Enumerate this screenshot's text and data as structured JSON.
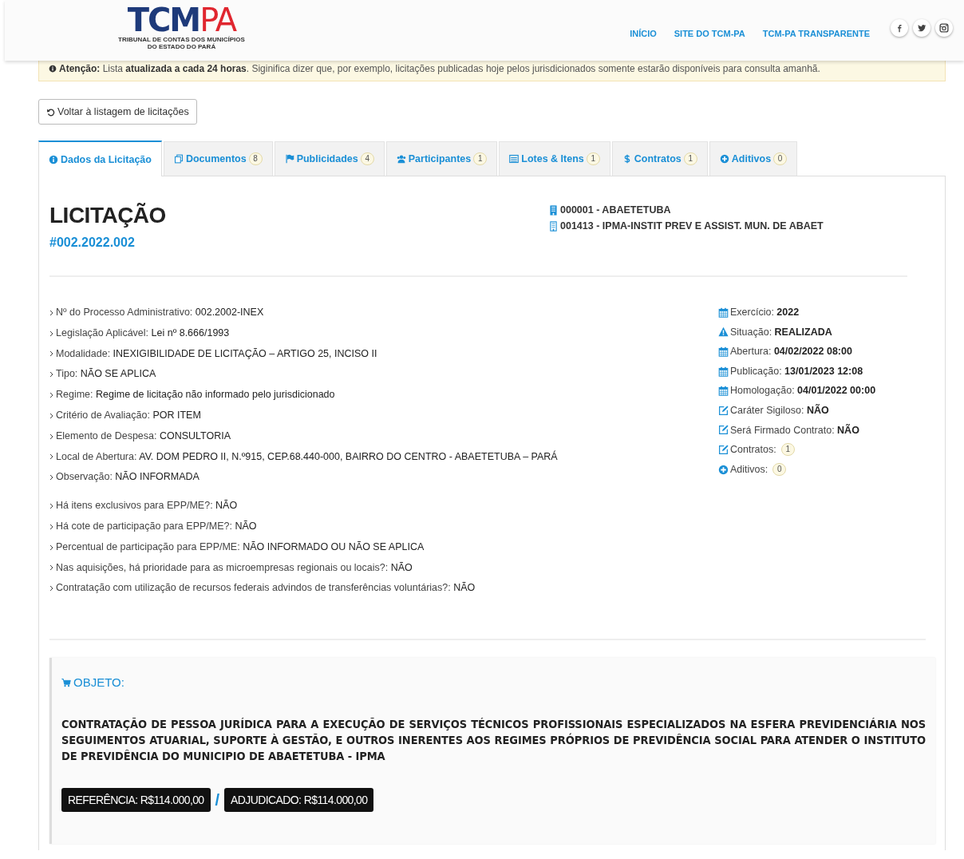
{
  "header": {
    "logo": {
      "dark": "TCM",
      "accent": "PA",
      "subtitle_lines": [
        "TRIBUNAL DE CONTAS DOS MUNICÍPIOS",
        "DO ESTADO DO PARÁ"
      ]
    },
    "nav": [
      "INÍCIO",
      "SITE DO TCM-PA",
      "TCM-PA TRANSPARENTE"
    ],
    "social": [
      {
        "kind": "facebook"
      },
      {
        "kind": "twitter"
      },
      {
        "kind": "instagram"
      }
    ]
  },
  "notice": {
    "text": "**Atenção:** Lista **atualizada a cada 24 horas**. Siginifica dizer que, por exemplo, licitações publicadas hoje pelos jurisdicionados somente estarão disponíveis para consulta amanhã."
  },
  "back_button": "Voltar à listagem de licitações",
  "tabs": [
    {
      "label": "Dados da Licitação",
      "kind": "info",
      "selected": true
    },
    {
      "label": "Documentos",
      "kind": "documents",
      "count": "8",
      "selected": false
    },
    {
      "label": "Publicidades",
      "kind": "publicity",
      "count": "4",
      "selected": false
    },
    {
      "label": "Participantes",
      "kind": "participants",
      "count": "1",
      "selected": false
    },
    {
      "label": "Lotes & Itens",
      "kind": "lots",
      "count": "1",
      "selected": false
    },
    {
      "label": "Contratos",
      "kind": "contracts",
      "count": "1",
      "selected": false
    },
    {
      "label": "Aditivos",
      "kind": "amendments",
      "count": "0",
      "selected": false
    }
  ],
  "detail": {
    "title": "LICITAÇÃO",
    "number": "#002.2022.002",
    "units": [
      {
        "kind": "municipality",
        "text": "000001 - ABAETETUBA"
      },
      {
        "kind": "entity",
        "text": "001413 - IPMA-INSTIT PREV E ASSIST. MUN. DE ABAET"
      }
    ],
    "field_groups": [
      [
        {
          "label": "Nº do Processo Administrativo:",
          "value": "002.2002-INEX"
        },
        {
          "label": "Legislação Aplicável:",
          "value": "Lei nº 8.666/1993"
        },
        {
          "label": "Modalidade:",
          "value": "INEXIGIBILIDADE DE LICITAÇÃO – ARTIGO 25, INCISO II"
        },
        {
          "label": "Tipo:",
          "value": "NÃO SE APLICA"
        },
        {
          "label": "Regime:",
          "value": "Regime de licitação não informado pelo jurisdicionado"
        },
        {
          "label": "Critério de Avaliação:",
          "value": "POR ITEM"
        },
        {
          "label": "Elemento de Despesa:",
          "value": "CONSULTORIA"
        },
        {
          "label": "Local de Abertura:",
          "value": "AV. DOM PEDRO II, N.º915, CEP.68.440-000, BAIRRO DO CENTRO - ABAETETUBA – PARÁ"
        },
        {
          "label": "Observação:",
          "value": "NÃO INFORMADA"
        }
      ],
      [
        {
          "label": "Há itens exclusivos para EPP/ME?:",
          "value": "NÃO"
        },
        {
          "label": "Há cote de participação para EPP/ME?:",
          "value": "NÃO"
        },
        {
          "label": "Percentual de participação para EPP/ME:",
          "value": "NÃO INFORMADO OU NÃO SE APLICA"
        },
        {
          "label": "Nas aquisições, há prioridade para as microempresas regionais ou locais?:",
          "value": "NÃO"
        },
        {
          "label": "Contratação com utilização de recursos federais advindos de transferências voluntárias?:",
          "value": "NÃO"
        }
      ]
    ],
    "facts": [
      {
        "kind": "date",
        "label": "Exercício:",
        "value": "2022"
      },
      {
        "kind": "status",
        "label": "Situação:",
        "value": "REALIZADA"
      },
      {
        "kind": "date",
        "label": "Abertura:",
        "value": "04/02/2022 08:00"
      },
      {
        "kind": "date",
        "label": "Publicação:",
        "value": "13/01/2023 12:08"
      },
      {
        "kind": "date",
        "label": "Homologação:",
        "value": "04/01/2022 00:00"
      },
      {
        "kind": "answer",
        "label": "Caráter Sigiloso:",
        "value": "NÃO"
      },
      {
        "kind": "answer",
        "label": "Será Firmado Contrato:",
        "value": "NÃO"
      },
      {
        "kind": "contracts",
        "label": "Contratos:",
        "value": "1"
      },
      {
        "kind": "amendments",
        "label": "Aditivos:",
        "value": "0"
      }
    ],
    "object": {
      "label": "OBJETO:",
      "text": "CONTRATAÇÃO DE PESSOA JURÍDICA PARA A EXECUÇÃO DE SERVIÇOS TÉCNICOS PROFISSIONAIS ESPECIALIZADOS NA ESFERA PREVIDENCIÁRIA NOS SEGUIMENTOS ATUARIAL, SUPORTE À GESTÃO, E OUTROS INERENTES AOS REGIMES PRÓPRIOS DE PREVIDÊNCIA SOCIAL PARA ATENDER O INSTITUTO DE PREVIDÊNCIA DO MUNICIPIO DE ABAETETUBA - IPMA",
      "reference": "REFERÊNCIA: R$114.000,00",
      "separator": "/",
      "adjudicated": "ADJUDICADO: R$114.000,00"
    }
  }
}
